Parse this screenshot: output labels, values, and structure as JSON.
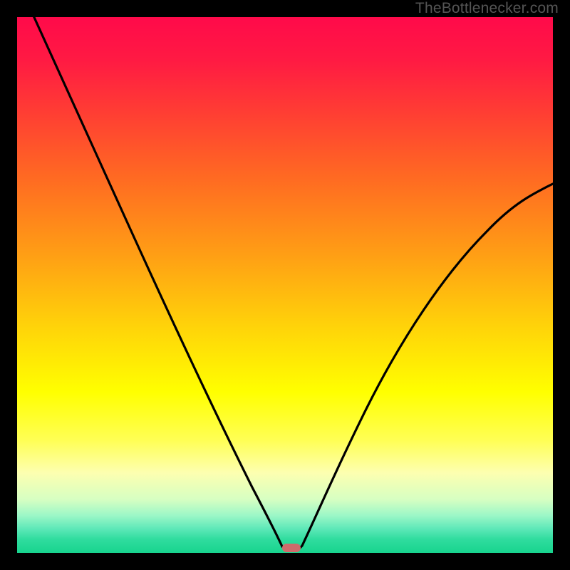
{
  "watermark": "TheBottlenecker.com",
  "colors": {
    "marker_fill": "#cf6b6b",
    "curve_stroke": "#000000"
  },
  "chart_data": {
    "type": "line",
    "title": "",
    "xlabel": "",
    "ylabel": "",
    "xlim": [
      0,
      100
    ],
    "ylim": [
      0,
      100
    ],
    "grid": false,
    "legend": false,
    "annotations": [],
    "marker": {
      "x": 50.5,
      "y": 0.7,
      "shape": "pill"
    },
    "series": [
      {
        "name": "left-branch",
        "x": [
          3,
          6,
          10,
          15,
          20,
          25,
          30,
          35,
          40,
          44,
          47,
          49,
          50
        ],
        "y": [
          100,
          92,
          83,
          73,
          63,
          53,
          43,
          33,
          22,
          12,
          5,
          1.2,
          0.6
        ]
      },
      {
        "name": "right-branch",
        "x": [
          52,
          54,
          57,
          61,
          66,
          72,
          78,
          85,
          92,
          100
        ],
        "y": [
          0.9,
          3,
          9,
          17,
          27,
          37,
          46,
          54,
          61,
          69
        ]
      }
    ]
  }
}
